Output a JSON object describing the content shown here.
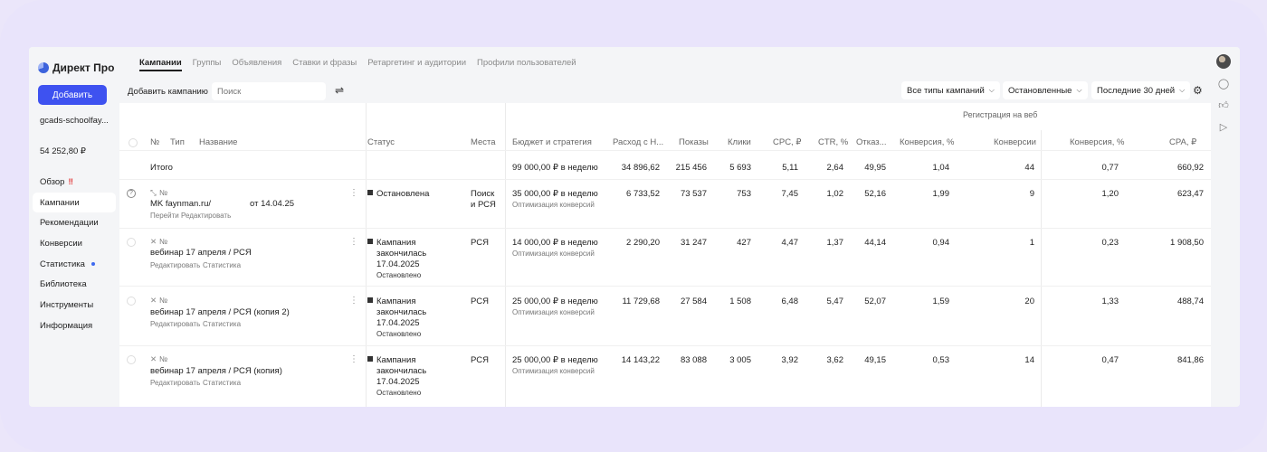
{
  "sidebar": {
    "logo": "Директ Про",
    "add_button": "Добавить",
    "account": "gcads-schoolfay...",
    "balance": "54 252,80 ₽",
    "items": [
      {
        "label": "Обзор",
        "flag": "‼"
      },
      {
        "label": "Кампании"
      },
      {
        "label": "Рекомендации"
      },
      {
        "label": "Конверсии"
      },
      {
        "label": "Статистика"
      },
      {
        "label": "Библиотека"
      },
      {
        "label": "Инструменты"
      },
      {
        "label": "Информация"
      }
    ]
  },
  "tabs": [
    "Кампании",
    "Группы",
    "Объявления",
    "Ставки и фразы",
    "Ретаргетинг и аудитории",
    "Профили пользователей"
  ],
  "toolbar": {
    "add_campaign": "Добавить кампанию",
    "search_placeholder": "Поиск",
    "filter_types": "Все типы кампаний",
    "filter_status": "Остановленные",
    "filter_period": "Последние 30 дней"
  },
  "table": {
    "group_header": "Регистрация на веб",
    "headers": [
      "№",
      "Тип",
      "Название",
      "Статус",
      "Места",
      "Бюджет и стратегия",
      "Расход с Н...",
      "Показы",
      "Клики",
      "CPC, ₽",
      "CTR, %",
      "Отказ...",
      "Конверсия, %",
      "Конверсии",
      "Конверсия, %",
      "CPA, ₽"
    ],
    "total": {
      "label": "Итого",
      "budget": "99 000,00 ₽ в неделю",
      "spend": "34 896,62",
      "impressions": "215 456",
      "clicks": "5 693",
      "cpc": "5,11",
      "ctr": "2,64",
      "bounce": "49,95",
      "conv_rate": "1,04",
      "conversions": "44",
      "conv_rate2": "0,77",
      "cpa": "660,92"
    },
    "rows": [
      {
        "num": "№",
        "name": "MK faynman.ru/",
        "name_suffix": "от 14.04.25",
        "actions": [
          "Перейти",
          "Редактировать"
        ],
        "status": [
          "Остановлена"
        ],
        "places": [
          "Поиск",
          "и РСЯ"
        ],
        "budget": "35 000,00 ₽ в неделю",
        "strategy": "Оптимизация конверсий",
        "spend": "6 733,52",
        "impressions": "73 537",
        "clicks": "753",
        "cpc": "7,45",
        "ctr": "1,02",
        "bounce": "52,16",
        "conv_rate": "1,99",
        "conversions": "9",
        "conv_rate2": "1,20",
        "cpa": "623,47"
      },
      {
        "num": "№",
        "name": "вебинар 17 апреля / РСЯ",
        "actions": [
          "Редактировать",
          "Статистика"
        ],
        "status": [
          "Кампания",
          "закончилась",
          "17.04.2025",
          "Остановлено"
        ],
        "places": [
          "РСЯ"
        ],
        "budget": "14 000,00 ₽ в неделю",
        "strategy": "Оптимизация конверсий",
        "spend": "2 290,20",
        "impressions": "31 247",
        "clicks": "427",
        "cpc": "4,47",
        "ctr": "1,37",
        "bounce": "44,14",
        "conv_rate": "0,94",
        "conversions": "1",
        "conv_rate2": "0,23",
        "cpa": "1 908,50"
      },
      {
        "num": "№",
        "name": "вебинар 17 апреля / РСЯ (копия 2)",
        "actions": [
          "Редактировать",
          "Статистика"
        ],
        "status": [
          "Кампания",
          "закончилась",
          "17.04.2025",
          "Остановлено"
        ],
        "places": [
          "РСЯ"
        ],
        "budget": "25 000,00 ₽ в неделю",
        "strategy": "Оптимизация конверсий",
        "spend": "11 729,68",
        "impressions": "27 584",
        "clicks": "1 508",
        "cpc": "6,48",
        "ctr": "5,47",
        "bounce": "52,07",
        "conv_rate": "1,59",
        "conversions": "20",
        "conv_rate2": "1,33",
        "cpa": "488,74"
      },
      {
        "num": "№",
        "name": "вебинар 17 апреля / РСЯ (копия)",
        "actions": [
          "Редактировать",
          "Статистика"
        ],
        "status": [
          "Кампания",
          "закончилась",
          "17.04.2025",
          "Остановлено"
        ],
        "places": [
          "РСЯ"
        ],
        "budget": "25 000,00 ₽ в неделю",
        "strategy": "Оптимизация конверсий",
        "spend": "14 143,22",
        "impressions": "83 088",
        "clicks": "3 005",
        "cpc": "3,92",
        "ctr": "3,62",
        "bounce": "49,15",
        "conv_rate": "0,53",
        "conversions": "14",
        "conv_rate2": "0,47",
        "cpa": "841,86"
      }
    ]
  }
}
